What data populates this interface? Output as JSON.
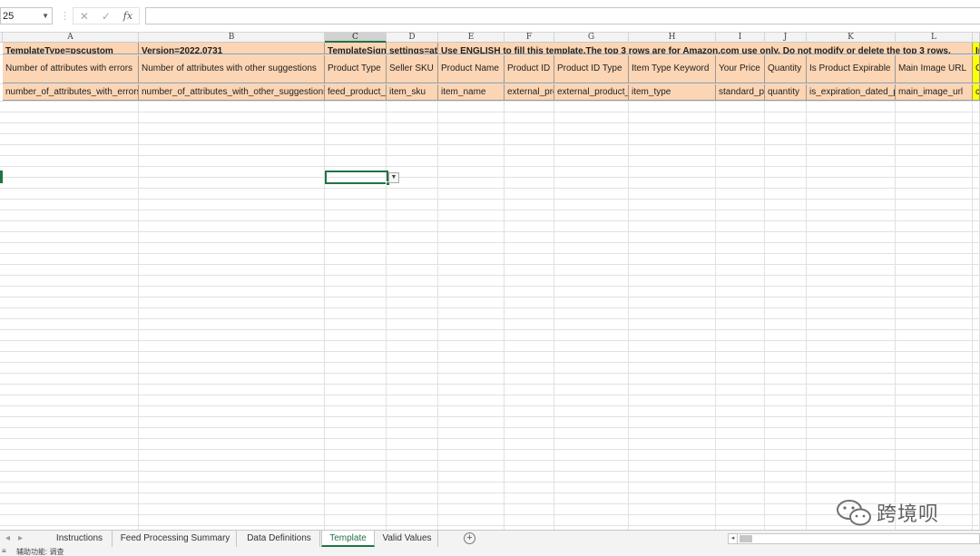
{
  "formula_bar": {
    "name_box": "25",
    "cancel_icon": "✕",
    "enter_icon": "✓",
    "fx_label": "fx",
    "formula_value": ""
  },
  "columns": [
    "A",
    "B",
    "C",
    "D",
    "E",
    "F",
    "G",
    "H",
    "I",
    "J",
    "K",
    "L"
  ],
  "selected_column": "C",
  "rows": [
    [
      "TemplateType=pscustom",
      "Version=2022.0731",
      "TemplateSignat",
      "settings=attr",
      "Use ENGLISH to fill this template.The top 3 rows are for Amazon.com use only. Do not modify or delete the top 3 rows.",
      "",
      "",
      "",
      "",
      "",
      "",
      "",
      "In"
    ],
    [
      "Number of attributes with errors",
      "Number of attributes with other suggestions",
      "Product Type",
      "Seller SKU",
      "Product Name",
      "Product ID",
      "Product ID Type",
      "Item Type Keyword",
      "Your Price",
      "Quantity",
      "Is Product Expirable",
      "Main Image URL",
      "C"
    ],
    [
      "number_of_attributes_with_errors",
      "number_of_attributes_with_other_suggestions",
      "feed_product_type",
      "item_sku",
      "item_name",
      "external_product_id",
      "external_product_id_type",
      "item_type",
      "standard_price",
      "quantity",
      "is_expiration_dated_product",
      "main_image_url",
      "c"
    ]
  ],
  "sheet_tabs": [
    "Instructions",
    "Feed Processing Summary",
    "Data Definitions",
    "Template",
    "Valid Values"
  ],
  "active_tab": "Template",
  "status": {
    "accessibility": "辅助功能: 调查"
  },
  "watermark": "跨境呗",
  "colors": {
    "header_fill": "#fcd5b4",
    "highlight_fill": "#ffff00",
    "accent": "#217346"
  }
}
